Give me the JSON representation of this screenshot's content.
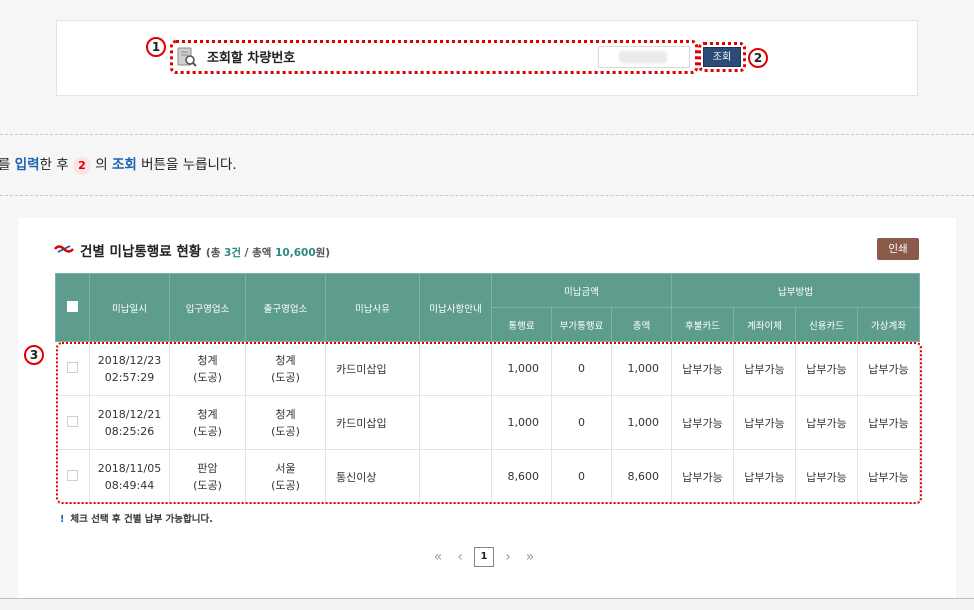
{
  "search": {
    "marker1": "1",
    "label": "조회할 차량번호",
    "button": "조회",
    "marker2": "2"
  },
  "instruction": {
    "part1": "를 ",
    "highlight1": "입력",
    "part2": "한 후 ",
    "marker": "2",
    "part3": " 의 ",
    "highlight2": "조회",
    "part4": " 버튼을 누릅니다."
  },
  "result": {
    "title": "건별 미납통행료 현황",
    "summary_prefix": "(총 ",
    "count": "3건",
    "summary_mid": " / 총액 ",
    "total": "10,600",
    "summary_suffix": "원)",
    "print_label": "인쇄",
    "marker3": "3",
    "headers": {
      "date": "미납일시",
      "entry": "입구영업소",
      "exit": "출구영업소",
      "reason": "미납사유",
      "guide": "미납사항안내",
      "amount_group": "미납금액",
      "toll": "통행료",
      "extra": "부가통행료",
      "sum": "총액",
      "pay_group": "납부방법",
      "postpaid": "후불카드",
      "transfer": "계좌이체",
      "credit": "신용카드",
      "virtual": "가상계좌"
    },
    "rows": [
      {
        "date": "2018/12/23",
        "time": "02:57:29",
        "entry": "청계",
        "entry_sub": "(도공)",
        "exit": "청계",
        "exit_sub": "(도공)",
        "reason": "카드미삽입",
        "guide": "",
        "toll": "1,000",
        "extra": "0",
        "sum": "1,000",
        "postpaid": "납부가능",
        "transfer": "납부가능",
        "credit": "납부가능",
        "virtual": "납부가능"
      },
      {
        "date": "2018/12/21",
        "time": "08:25:26",
        "entry": "청계",
        "entry_sub": "(도공)",
        "exit": "청계",
        "exit_sub": "(도공)",
        "reason": "카드미삽입",
        "guide": "",
        "toll": "1,000",
        "extra": "0",
        "sum": "1,000",
        "postpaid": "납부가능",
        "transfer": "납부가능",
        "credit": "납부가능",
        "virtual": "납부가능"
      },
      {
        "date": "2018/11/05",
        "time": "08:49:44",
        "entry": "판암",
        "entry_sub": "(도공)",
        "exit": "서울",
        "exit_sub": "(도공)",
        "reason": "통신이상",
        "guide": "",
        "toll": "8,600",
        "extra": "0",
        "sum": "8,600",
        "postpaid": "납부가능",
        "transfer": "납부가능",
        "credit": "납부가능",
        "virtual": "납부가능"
      }
    ],
    "note_bang": "!",
    "note": "체크 선택 후 건별 납부 가능합니다."
  },
  "pager": {
    "first": "«",
    "prev": "‹",
    "current": "1",
    "next": "›",
    "last": "»"
  },
  "colors": {
    "header_green": "#5e9c8d",
    "highlight_red": "#e00000",
    "query_blue": "#2c4b77",
    "print_brown": "#8a5a4a",
    "link_blue": "#1a62b5"
  }
}
